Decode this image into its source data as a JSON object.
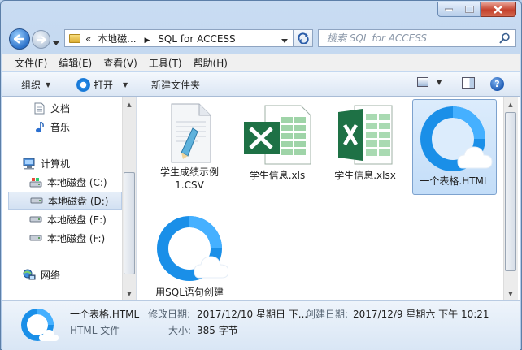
{
  "address": {
    "breadcrumb_prefix": "«",
    "crumb1": "本地磁...",
    "crumb2": "SQL for ACCESS"
  },
  "search": {
    "placeholder": "搜索 SQL for ACCESS"
  },
  "menu": [
    "文件(F)",
    "编辑(E)",
    "查看(V)",
    "工具(T)",
    "帮助(H)"
  ],
  "toolbar": {
    "organize": "组织",
    "open": "打开",
    "new_folder": "新建文件夹"
  },
  "nav": {
    "docs": "文档",
    "music": "音乐",
    "computer": "计算机",
    "drive_c": "本地磁盘 (C:)",
    "drive_d": "本地磁盘 (D:)",
    "drive_e": "本地磁盘 (E:)",
    "drive_f": "本地磁盘 (F:)",
    "network": "网络"
  },
  "files": [
    {
      "name": "学生成绩示例1.CSV",
      "line1": "学生成绩示例",
      "line2": "1.CSV"
    },
    {
      "name": "学生信息.xls"
    },
    {
      "name": "学生信息.xlsx"
    },
    {
      "name": "一个表格.HTML"
    },
    {
      "name": "用SQL语句创建"
    }
  ],
  "details": {
    "name": "一个表格.HTML",
    "type": "HTML 文件",
    "modified_label": "修改日期:",
    "modified_value": "2017/12/10 星期日 下...",
    "created_label": "创建日期:",
    "created_value": "2017/12/9 星期六 下午 10:21",
    "size_label": "大小:",
    "size_value": "385 字节"
  },
  "colors": {
    "qq_blue": "#1a8fe8",
    "excel_green": "#1e7145"
  }
}
